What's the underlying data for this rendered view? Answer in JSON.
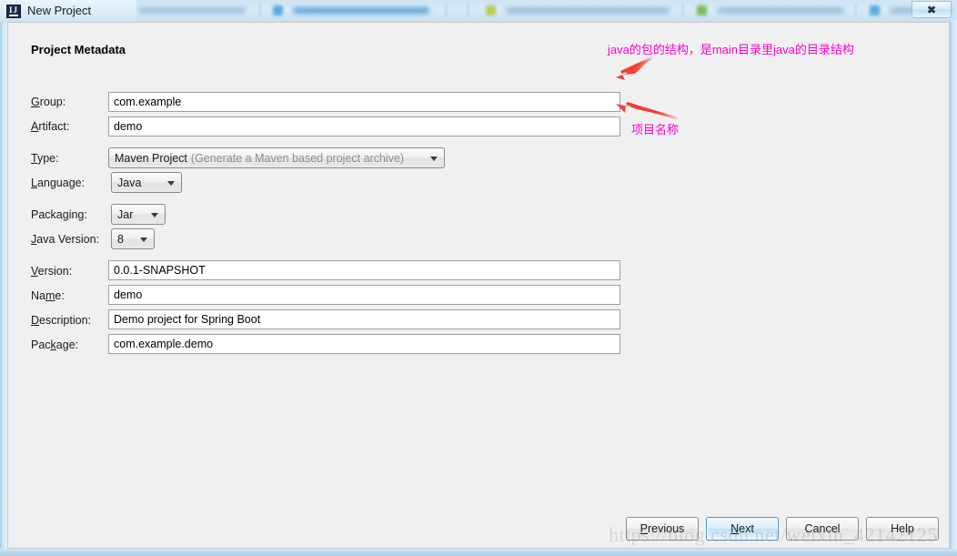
{
  "window": {
    "title": "New Project",
    "app_icon": "intellij-idea-icon",
    "close_label": "✖"
  },
  "dialog": {
    "section_title": "Project Metadata"
  },
  "form": {
    "fields": [
      {
        "label_pre": "",
        "label_mnemonic": "G",
        "label_post": "roup:",
        "value": "com.example",
        "type": "text"
      },
      {
        "label_pre": "",
        "label_mnemonic": "A",
        "label_post": "rtifact:",
        "value": "demo",
        "type": "text"
      },
      {
        "label_pre": "",
        "label_mnemonic": "T",
        "label_post": "ype:",
        "value": "Maven Project",
        "value_sub": "(Generate a Maven based project archive)",
        "type": "combo"
      },
      {
        "label_pre": "",
        "label_mnemonic": "L",
        "label_post": "anguage:",
        "value": "Java",
        "type": "combo"
      },
      {
        "label_pre": "Packa",
        "label_mnemonic": "g",
        "label_post": "ing:",
        "value": "Jar",
        "type": "combo"
      },
      {
        "label_pre": "",
        "label_mnemonic": "J",
        "label_post": "ava Version:",
        "value": "8",
        "type": "combo"
      },
      {
        "label_pre": "",
        "label_mnemonic": "V",
        "label_post": "ersion:",
        "value": "0.0.1-SNAPSHOT",
        "type": "text"
      },
      {
        "label_pre": "Na",
        "label_mnemonic": "m",
        "label_post": "e:",
        "value": "demo",
        "type": "text"
      },
      {
        "label_pre": "",
        "label_mnemonic": "D",
        "label_post": "escription:",
        "value": "Demo project for Spring Boot",
        "type": "text"
      },
      {
        "label_pre": "Pac",
        "label_mnemonic": "k",
        "label_post": "age:",
        "value": "com.example.demo",
        "type": "text"
      }
    ]
  },
  "annotations": {
    "color": "#ff00d0",
    "arrow_color": "#f03b32",
    "note_top": "java的包的结构，是main目录里java的目录结构",
    "note_bottom": "项目名称"
  },
  "buttons": {
    "previous": {
      "pre": "",
      "mnemonic": "P",
      "post": "revious"
    },
    "next": {
      "pre": "",
      "mnemonic": "N",
      "post": "ext"
    },
    "cancel": {
      "pre": "Cancel",
      "mnemonic": "",
      "post": ""
    },
    "help": {
      "pre": "Help",
      "mnemonic": "",
      "post": ""
    }
  },
  "watermark": {
    "text": "https://blog.csdn.net/weixin_42142125"
  }
}
